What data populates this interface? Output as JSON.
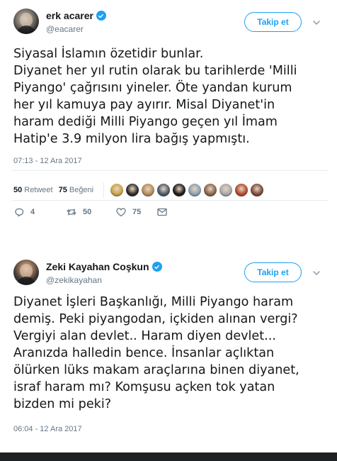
{
  "tweets": [
    {
      "author": {
        "name": "erk acarer",
        "handle": "@eacarer"
      },
      "follow_label": "Takip et",
      "text_lines": [
        "Siyasal İslamın özetidir bunlar.",
        "Diyanet her yıl rutin olarak bu tarihlerde 'Milli",
        "Piyango' çağrısını yineler. Öte yandan kurum",
        "her yıl kamuya pay ayırır. Misal Diyanet'in",
        "haram dediği Milli Piyango geçen yıl İmam",
        "Hatip'e 3.9 milyon lira bağış yapmıştı."
      ],
      "timestamp": "07:13 - 12 Ara 2017",
      "retweet_count": "50",
      "retweet_label": "Retweet",
      "like_count": "75",
      "like_label": "Beğeni",
      "likers_colors": [
        "#c9a24a",
        "#2a2a2a",
        "#b38b5a",
        "#4a5a6a",
        "#1a1a1a",
        "#8aa0b4",
        "#8a6248",
        "#a8a8a8",
        "#b04a2a",
        "#7a4a3a"
      ],
      "actions": {
        "reply": "4",
        "retweet": "50",
        "like": "75"
      }
    },
    {
      "author": {
        "name": "Zeki Kayahan Coşkun",
        "handle": "@zekikayahan"
      },
      "follow_label": "Takip et",
      "text_lines": [
        "Diyanet İşleri Başkanlığı, Milli Piyango haram",
        "demiş. Peki piyangodan, içkiden alınan vergi?",
        "Vergiyi alan devlet.. Haram diyen devlet...",
        "Aranızda halledin bence. İnsanlar açlıktan",
        "ölürken lüks makam araçlarına binen diyanet,",
        "israf haram mı? Komşusu açken tok yatan",
        "bizden mi peki?"
      ],
      "timestamp": "06:04 - 12 Ara 2017"
    }
  ],
  "colors": {
    "accent": "#1da1f2",
    "text": "#14171a",
    "muted": "#657786",
    "divider": "#e6ecf0"
  },
  "icons": [
    "verified-badge-icon",
    "chevron-down-icon",
    "reply-icon",
    "retweet-icon",
    "like-icon",
    "direct-message-icon"
  ]
}
